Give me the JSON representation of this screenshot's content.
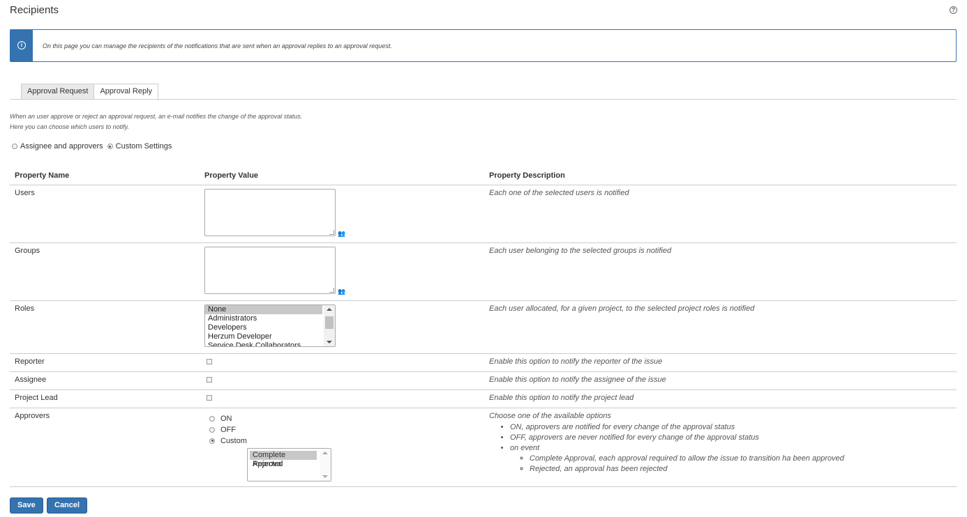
{
  "page": {
    "title": "Recipients",
    "help_icon": "help-icon"
  },
  "info": {
    "icon": "info-icon",
    "text": "On this page you can manage the recipients of the notifications that are sent when an approval replies to an approval request."
  },
  "tabs": [
    {
      "label": "Approval Request",
      "active": false
    },
    {
      "label": "Approval Reply",
      "active": true
    }
  ],
  "description": {
    "line1": "When an user approve or reject an approval request, an e-mail notifies the change of the approval status.",
    "line2": "Here you can choose which users to notify."
  },
  "mode": {
    "options": [
      "Assignee and approvers",
      "Custom Settings"
    ],
    "selected": "Custom Settings"
  },
  "table": {
    "headers": [
      "Property Name",
      "Property Value",
      "Property Description"
    ],
    "users": {
      "name": "Users",
      "value": "",
      "description": "Each one of the selected users is notified"
    },
    "groups": {
      "name": "Groups",
      "value": "",
      "description": "Each user belonging to the selected groups is notified"
    },
    "roles": {
      "name": "Roles",
      "options": [
        "None",
        "Administrators",
        "Developers",
        "Herzum Developer",
        "Service Desk Collaborators"
      ],
      "selected": "None",
      "description": "Each user allocated, for a given project, to the selected project roles is notified"
    },
    "reporter": {
      "name": "Reporter",
      "checked": false,
      "description": "Enable this option to notify the reporter of the issue"
    },
    "assignee": {
      "name": "Assignee",
      "checked": false,
      "description": "Enable this option to notify the assignee of the issue"
    },
    "project_lead": {
      "name": "Project Lead",
      "checked": false,
      "description": "Enable this option to notify the project lead"
    },
    "approvers": {
      "name": "Approvers",
      "options": [
        "ON",
        "OFF",
        "Custom"
      ],
      "selected": "Custom",
      "events": [
        "Complete Approval",
        "Rejected"
      ],
      "selected_event": "Complete Approval",
      "description": {
        "intro": "Choose one of the available options",
        "on": "ON, approvers are notified for every change of the approval status",
        "off": "OFF, approvers are never notified for every change of the approval status",
        "event": "on event",
        "complete": "Complete Approval, each approval required to allow the issue to transition ha been approved",
        "rejected": "Rejected, an approval has been rejected"
      }
    }
  },
  "buttons": {
    "save": "Save",
    "cancel": "Cancel"
  }
}
